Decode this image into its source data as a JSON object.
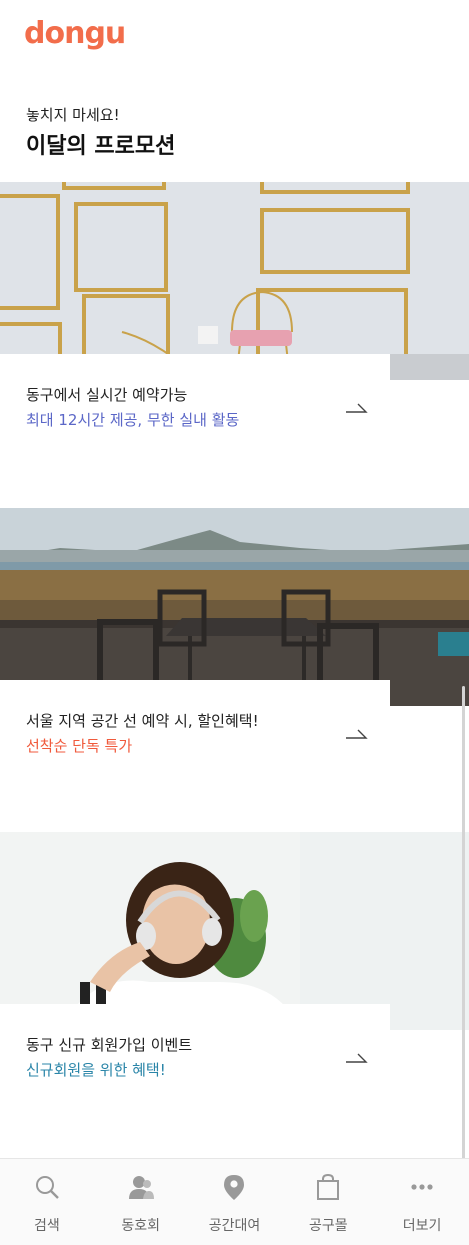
{
  "app": {
    "logo": "dongu",
    "brand_color": "#f26d4b"
  },
  "header": {
    "subtitle": "놓치지 마세요!",
    "title": "이달의 프로모션"
  },
  "promotions": [
    {
      "line1": "동구에서 실시간 예약가능",
      "line2": "최대 12시간 제공, 무한 실내 활동",
      "line2_color": "#5b67c7",
      "image": "studio-room-photo"
    },
    {
      "line1": "서울 지역 공간 선 예약 시, 할인혜택!",
      "line2": "선착순 단독 특가",
      "line2_color": "#f05a3c",
      "image": "rooftop-terrace-photo"
    },
    {
      "line1": "동구 신규 회원가입 이벤트",
      "line2": "신규회원을 위한 혜택!",
      "line2_color": "#2a85a8",
      "image": "woman-headphones-photo"
    }
  ],
  "nav": {
    "items": [
      {
        "label": "검색",
        "icon": "search-icon"
      },
      {
        "label": "동호회",
        "icon": "user-icon"
      },
      {
        "label": "공간대여",
        "icon": "location-pin-icon"
      },
      {
        "label": "공구몰",
        "icon": "shopping-bag-icon"
      },
      {
        "label": "더보기",
        "icon": "more-icon"
      }
    ]
  }
}
